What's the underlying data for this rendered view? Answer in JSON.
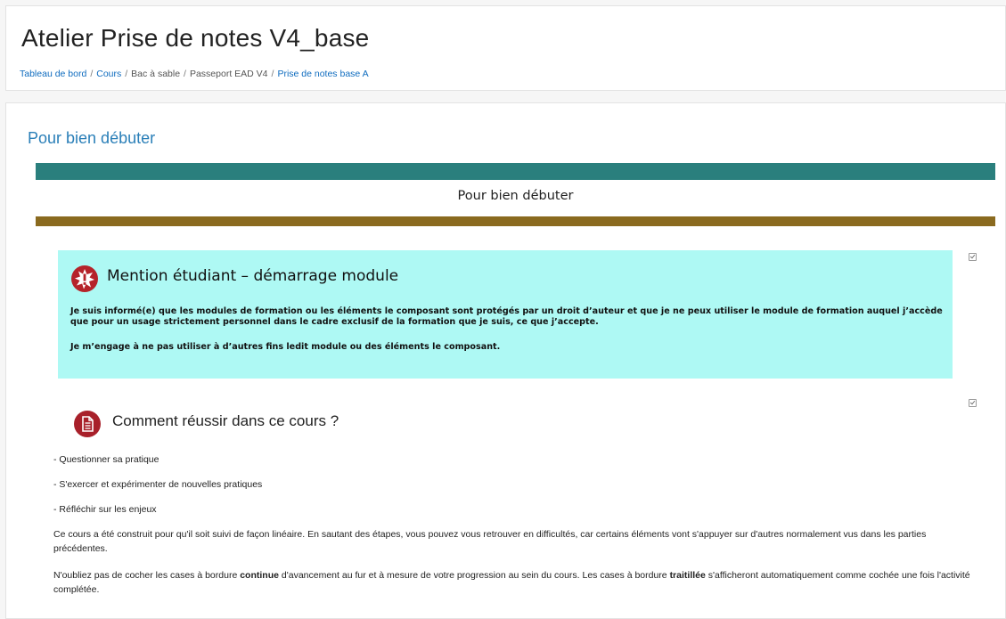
{
  "colors": {
    "teal_band": "#2a7f7d",
    "gold_band": "#8a6a1f",
    "notice_bg": "#aef9f4",
    "notice_icon": "#b5232a",
    "comment_icon": "#a8202a",
    "link": "#0f6cbf"
  },
  "header": {
    "title": "Atelier Prise de notes V4_base",
    "breadcrumb": [
      {
        "label": "Tableau de bord",
        "link": true
      },
      {
        "label": "Cours",
        "link": true
      },
      {
        "label": "Bac à sable",
        "link": false
      },
      {
        "label": "Passeport EAD V4",
        "link": false
      },
      {
        "label": "Prise de notes base A",
        "link": true
      }
    ]
  },
  "section": {
    "title": "Pour bien débuter",
    "banner_title": "Pour bien débuter"
  },
  "notice": {
    "icon": "warning-burst-icon",
    "title": "Mention étudiant – démarrage module",
    "paragraph1": "Je suis informé(e) que les modules de formation ou les éléments le composant sont protégés par un droit d’auteur et que je ne peux utiliser le module de formation auquel j’accède que pour un usage strictement personnel dans le cadre exclusif de la formation que je suis, ce que j’accepte.",
    "paragraph2": "Je m’engage à ne pas utiliser à d’autres fins ledit module ou des éléments le composant."
  },
  "activity": {
    "icon": "document-icon",
    "title": "Comment réussir dans ce cours ?",
    "items": [
      "- Questionner sa pratique",
      "- S'exercer et expérimenter de nouvelles pratiques",
      "- Réfléchir sur les enjeux"
    ],
    "paragraph": "Ce cours a été construit pour qu'il soit suivi de façon linéaire. En sautant des étapes, vous pouvez vous retrouver en difficultés, car certains éléments vont s'appuyer sur d'autres normalement vus dans les parties précédentes.",
    "note_before_bold1": "N'oubliez pas de cocher les cases à bordure ",
    "note_bold1": "continue",
    "note_mid": " d'avancement au fur et à mesure de votre progression au sein du cours. Les cases à bordure ",
    "note_bold2": "traitillée",
    "note_after": "  s'afficheront  automatiquement comme cochée une fois l'activité complétée."
  }
}
